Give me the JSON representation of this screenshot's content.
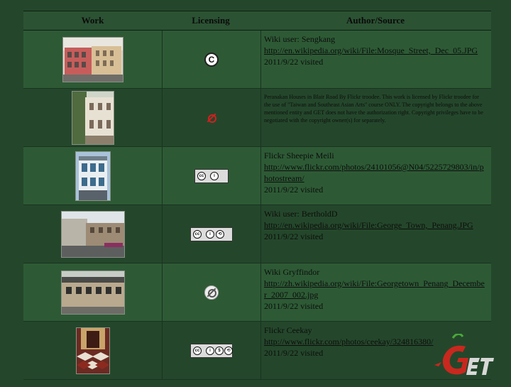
{
  "header": {
    "work": "Work",
    "licensing": "Licensing",
    "author": "Author/Source"
  },
  "rows": [
    {
      "license_icon": "copyright-icon",
      "author_lines": [
        "Wiki user: Sengkang"
      ],
      "link": "http://en.wikipedia.org/wiki/File:Mosque_Street,_Dec_05.JPG",
      "visited": "2011/9/22 visited"
    },
    {
      "license_icon": "no-copyright-red-icon",
      "note": "Peranakan Houses in Blair Road By Flickr troodee. This work is licensed by Flickr troodee for the use of \"Taiwan and Southeast Asian Arts\" course ONLY. The copyright belongs to the above mentioned entity and GET does not have the authorization right. Copyright privileges have to be negotiated with the copyright owner(s) for separately."
    },
    {
      "license_icon": "cc-by-icon",
      "author_lines": [
        "Flickr Sheepie Meili"
      ],
      "link": "http://www.flickr.com/photos/24101056@N04/5225729803/in/photostream/",
      "visited": "2011/9/22 visited"
    },
    {
      "license_icon": "cc-by-sa-icon",
      "author_lines": [
        "Wiki user: BertholdD"
      ],
      "link": "http://en.wikipedia.org/wiki/File:George_Town,_Penang.JPG",
      "visited": "2011/9/22 visited"
    },
    {
      "license_icon": "public-domain-icon",
      "author_lines": [
        "Wiki Gryffindor"
      ],
      "link": "http://zh.wikipedia.org/wiki/File:Georgetown_Penang_December_2007_002.jpg",
      "visited": "2011/9/22 visited"
    },
    {
      "license_icon": "cc-by-nc-sa-icon",
      "author_lines": [
        "Flickr Ceekay"
      ],
      "link": "http://www.flickr.com/photos/ceekay/324816380/",
      "visited": "2011/9/22 visited"
    }
  ],
  "colors": {
    "background": "#24472b",
    "row_alt": "#2d5a35",
    "logo_green": "#4aa83a",
    "logo_red": "#c8281e"
  }
}
